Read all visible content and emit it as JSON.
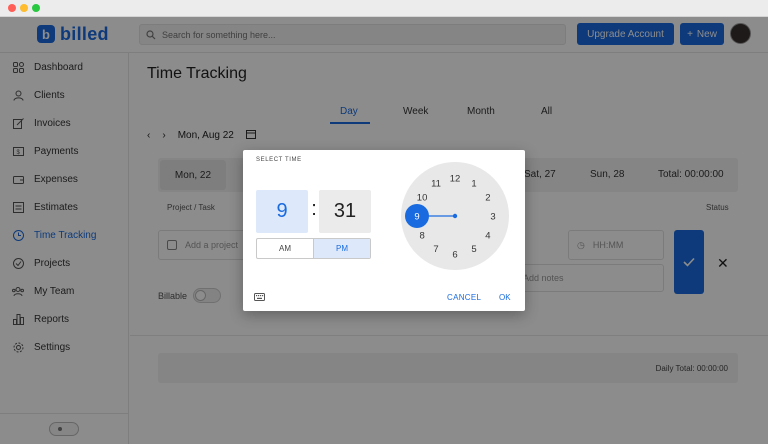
{
  "window": {
    "controls": [
      "close",
      "minimize",
      "maximize"
    ]
  },
  "header": {
    "logo_mark": "b",
    "logo_text": "billed",
    "search_placeholder": "Search for something here...",
    "upgrade_label": "Upgrade Account",
    "new_label": "New",
    "new_icon": "plus-icon"
  },
  "sidebar": {
    "items": [
      {
        "label": "Dashboard",
        "icon": "dashboard-icon",
        "active": false
      },
      {
        "label": "Clients",
        "icon": "user-icon",
        "active": false
      },
      {
        "label": "Invoices",
        "icon": "invoice-icon",
        "active": false
      },
      {
        "label": "Payments",
        "icon": "payment-icon",
        "active": false
      },
      {
        "label": "Expenses",
        "icon": "wallet-icon",
        "active": false
      },
      {
        "label": "Estimates",
        "icon": "estimate-icon",
        "active": false
      },
      {
        "label": "Time Tracking",
        "icon": "clock-icon",
        "active": true
      },
      {
        "label": "Projects",
        "icon": "check-circle-icon",
        "active": false
      },
      {
        "label": "My Team",
        "icon": "team-icon",
        "active": false
      },
      {
        "label": "Reports",
        "icon": "reports-icon",
        "active": false
      },
      {
        "label": "Settings",
        "icon": "gear-icon",
        "active": false
      }
    ]
  },
  "main": {
    "title": "Time Tracking",
    "tabs": [
      {
        "label": "Day",
        "active": true
      },
      {
        "label": "Week",
        "active": false
      },
      {
        "label": "Month",
        "active": false
      },
      {
        "label": "All",
        "active": false
      }
    ],
    "current_date": "Mon, Aug 22",
    "week": {
      "selected": "Mon, 22",
      "sat": "Sat, 27",
      "sun": "Sun, 28",
      "total": "Total: 00:00:00"
    },
    "columns": {
      "project": "Project / Task",
      "status": "Status"
    },
    "entry": {
      "project_placeholder": "Add a project",
      "time_placeholder": "HH:MM",
      "notes_placeholder": "Add notes",
      "billable_label": "Billable"
    },
    "daily_total": "Daily Total: 00:00:00"
  },
  "time_picker": {
    "title": "SELECT TIME",
    "hour": "9",
    "colon": ":",
    "minute": "31",
    "am_label": "AM",
    "pm_label": "PM",
    "selected_period": "PM",
    "selected_hour": 9,
    "clock_numbers": [
      "12",
      "1",
      "2",
      "3",
      "4",
      "5",
      "6",
      "7",
      "8",
      "9",
      "10",
      "11"
    ],
    "cancel_label": "CANCEL",
    "ok_label": "OK",
    "accent": "#1a6be0"
  }
}
